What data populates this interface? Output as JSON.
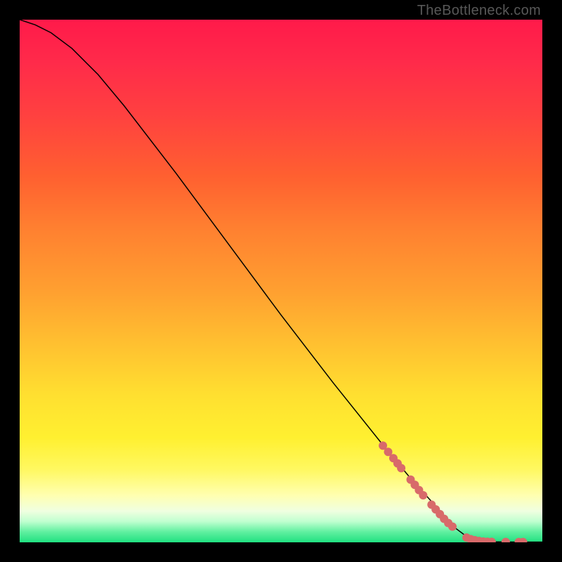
{
  "watermark": "TheBottleneck.com",
  "chart_data": {
    "type": "line",
    "title": "",
    "xlabel": "",
    "ylabel": "",
    "xlim": [
      0,
      100
    ],
    "ylim": [
      0,
      100
    ],
    "curve": [
      {
        "x": 0,
        "y": 100
      },
      {
        "x": 3,
        "y": 99
      },
      {
        "x": 6,
        "y": 97.5
      },
      {
        "x": 10,
        "y": 94.5
      },
      {
        "x": 15,
        "y": 89.5
      },
      {
        "x": 20,
        "y": 83.5
      },
      {
        "x": 30,
        "y": 70.5
      },
      {
        "x": 40,
        "y": 57.0
      },
      {
        "x": 50,
        "y": 43.5
      },
      {
        "x": 60,
        "y": 30.5
      },
      {
        "x": 70,
        "y": 18.0
      },
      {
        "x": 75,
        "y": 12.0
      },
      {
        "x": 80,
        "y": 6.5
      },
      {
        "x": 83,
        "y": 3.0
      },
      {
        "x": 85,
        "y": 1.5
      },
      {
        "x": 87,
        "y": 0.5
      },
      {
        "x": 90,
        "y": 0.1
      },
      {
        "x": 95,
        "y": 0.05
      },
      {
        "x": 100,
        "y": 0.05
      }
    ],
    "markers": [
      {
        "x": 69.5,
        "y": 18.5
      },
      {
        "x": 70.5,
        "y": 17.3
      },
      {
        "x": 71.5,
        "y": 16.1
      },
      {
        "x": 72.3,
        "y": 15.1
      },
      {
        "x": 73.0,
        "y": 14.2
      },
      {
        "x": 74.8,
        "y": 12.0
      },
      {
        "x": 75.6,
        "y": 11.0
      },
      {
        "x": 76.4,
        "y": 10.0
      },
      {
        "x": 77.2,
        "y": 9.0
      },
      {
        "x": 78.8,
        "y": 7.2
      },
      {
        "x": 79.6,
        "y": 6.3
      },
      {
        "x": 80.4,
        "y": 5.4
      },
      {
        "x": 81.2,
        "y": 4.5
      },
      {
        "x": 82.0,
        "y": 3.7
      },
      {
        "x": 82.8,
        "y": 3.0
      },
      {
        "x": 85.5,
        "y": 0.9
      },
      {
        "x": 86.3,
        "y": 0.6
      },
      {
        "x": 87.1,
        "y": 0.4
      },
      {
        "x": 87.9,
        "y": 0.25
      },
      {
        "x": 88.7,
        "y": 0.15
      },
      {
        "x": 89.5,
        "y": 0.1
      },
      {
        "x": 90.3,
        "y": 0.08
      },
      {
        "x": 93.0,
        "y": 0.06
      },
      {
        "x": 95.5,
        "y": 0.05
      },
      {
        "x": 96.3,
        "y": 0.05
      }
    ]
  }
}
